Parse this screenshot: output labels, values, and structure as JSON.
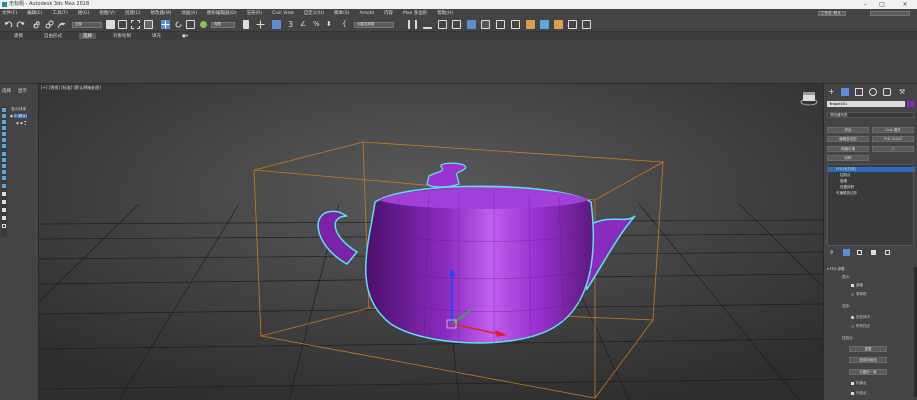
{
  "titlebar": {
    "title": "无标题 - Autodesk 3ds Max 2018"
  },
  "menubar": {
    "items": [
      "文件(F)",
      "编辑(E)",
      "工具(T)",
      "组(G)",
      "视图(V)",
      "创建(C)",
      "修改器(M)",
      "动画(A)",
      "图形编辑器(D)",
      "渲染(R)",
      "Civil View",
      "自定义(U)",
      "脚本(S)",
      "Arnold",
      "内容",
      "Max 多边形",
      "帮助(H)"
    ]
  },
  "workspace": {
    "label": "工作区: 默认"
  },
  "toolbar": {
    "selection_filter": "全部",
    "view_dropdown": "视图",
    "named_sel": "创建选择集"
  },
  "ribbon": {
    "tabs": [
      "建模",
      "自由形式",
      "选择",
      "对象绘制",
      "填充"
    ],
    "active_tab": "选择"
  },
  "scene_explorer": {
    "select_label": "选择",
    "display_label": "显示",
    "root_label": "0 (默认)",
    "hint": "显示/排序"
  },
  "viewport": {
    "label": "[+] [透视] [标准] [默认明暗处理]"
  },
  "command_panel": {
    "object_name": "Teapot001",
    "modifier_list": "修改器列表",
    "buttons": [
      "挤出",
      "Uvw 展开",
      "编辑多边形",
      "FFD 2x2x2",
      "网格平滑",
      "壳",
      "对称"
    ],
    "stack": [
      "FFD(长方体)",
      "控制点",
      "晶格",
      "设置体积",
      "可编辑多边形"
    ],
    "rollout_title": "FFD 参数",
    "display_group": "显示:",
    "display_options": [
      "晶格",
      "源体积"
    ],
    "deform_group": "变形:",
    "deform_options": [
      "仅在体内",
      "所有顶点"
    ],
    "control_group": "控制点:",
    "control_buttons": [
      "重置",
      "全部动画化",
      "与图形一致"
    ],
    "control_options": [
      "内部点",
      "外部点"
    ]
  }
}
